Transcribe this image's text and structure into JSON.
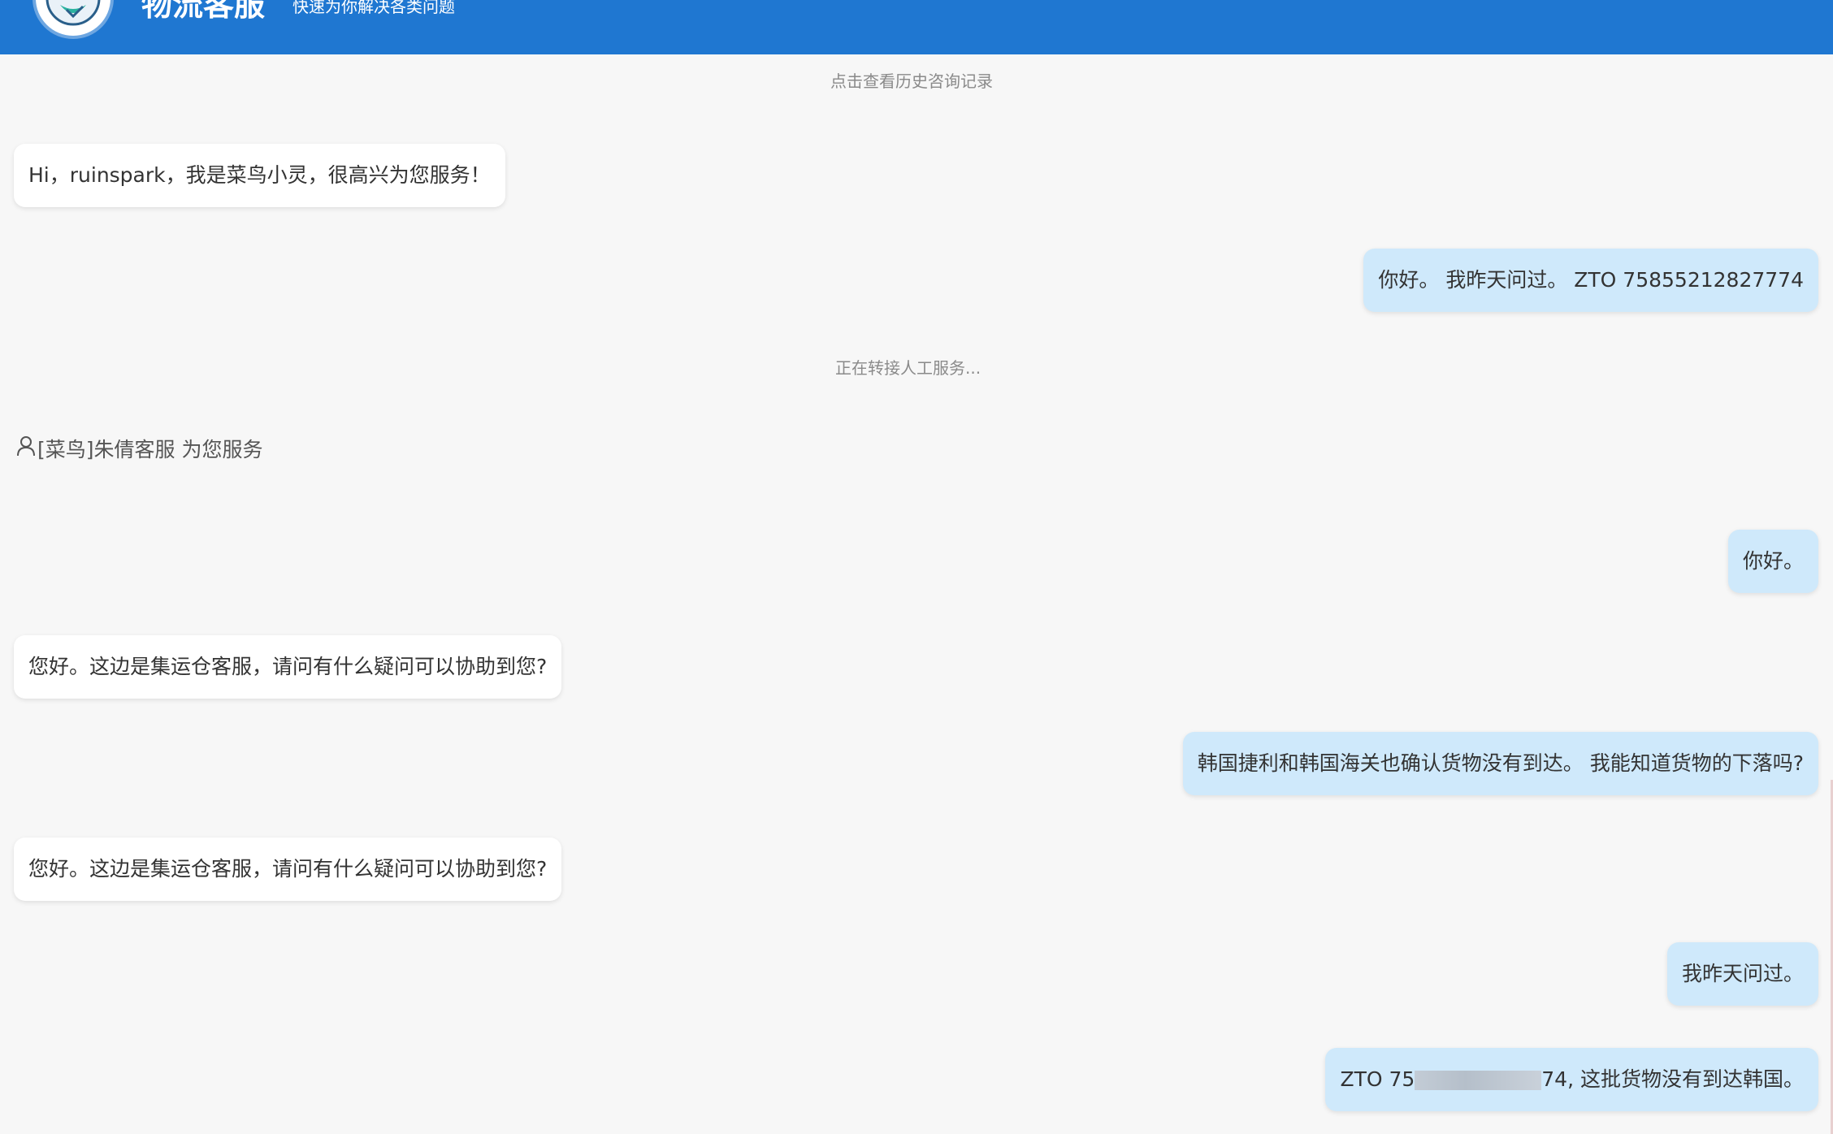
{
  "header": {
    "title": "物流客服",
    "subtitle": "快速为你解决各类问题",
    "logo_icon": "cainiao-logo-icon",
    "bg_color": "#1f77d1"
  },
  "history_link": "点击查看历史咨询记录",
  "messages": [
    {
      "side": "left",
      "text": "Hi，ruinspark，我是菜鸟小灵，很高兴为您服务！"
    },
    {
      "side": "right",
      "text": "你好。 我昨天问过。 ZTO 75855212827774"
    },
    {
      "side": "right",
      "text": "你好。"
    },
    {
      "side": "left",
      "text": "您好。这边是集运仓客服，请问有什么疑问可以协助到您?"
    },
    {
      "side": "right",
      "text": "韩国捷利和韩国海关也确认货物没有到达。 我能知道货物的下落吗?"
    },
    {
      "side": "left",
      "text": "您好。这边是集运仓客服，请问有什么疑问可以协助到您?"
    },
    {
      "side": "right",
      "text": "我昨天问过。"
    },
    {
      "side": "right",
      "text_prefix": "ZTO 75",
      "text_suffix": "74, 这批货物没有到达韩国。"
    }
  ],
  "transfer_notice": "正在转接人工服务...",
  "agent_line": {
    "icon": "person-icon",
    "text": "[菜鸟]朱倩客服 为您服务"
  }
}
